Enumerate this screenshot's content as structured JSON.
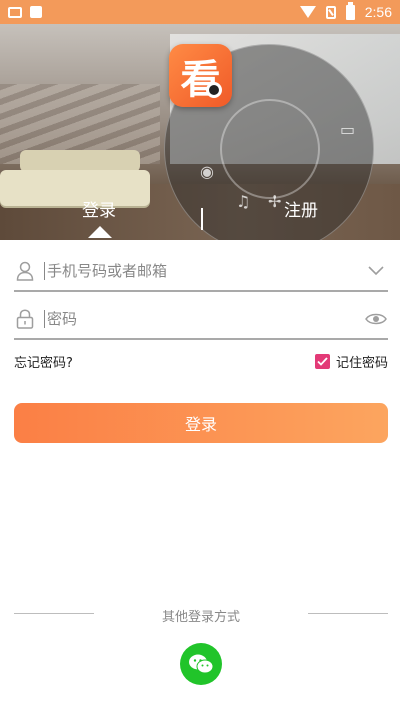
{
  "status_bar": {
    "time": "2:56"
  },
  "app": {
    "logo_char": "看"
  },
  "tabs": {
    "login": "登录",
    "register": "注册"
  },
  "form": {
    "user_placeholder": "手机号码或者邮箱",
    "password_placeholder": "密码",
    "forgot": "忘记密码?",
    "remember": "记住密码",
    "remember_checked": true,
    "login_button": "登录"
  },
  "other_login": {
    "label": "其他登录方式"
  },
  "colors": {
    "accent": "#fb7f45",
    "checkbox": "#e33a77",
    "wechat": "#21c42a"
  }
}
